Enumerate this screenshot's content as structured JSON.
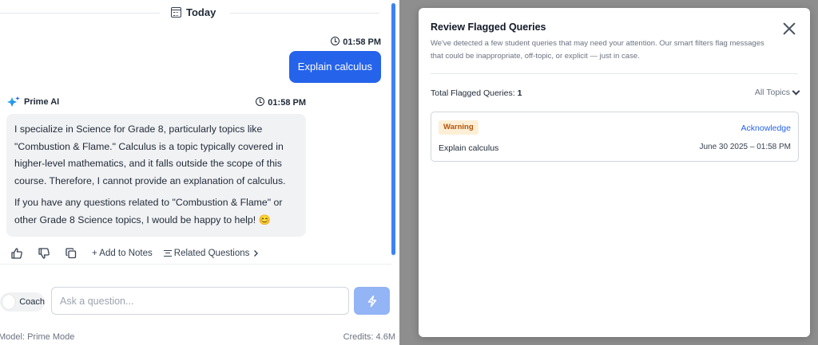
{
  "chat": {
    "day_label": "Today",
    "user_message": {
      "time": "01:58 PM",
      "text": "Explain calculus"
    },
    "ai_message": {
      "sender": "Prime AI",
      "time": "01:58 PM",
      "paragraph1": "I specialize in Science for Grade 8, particularly topics like \"Combustion & Flame.\" Calculus is a topic typically covered in higher-level mathematics, and it falls outside the scope of this course. Therefore, I cannot provide an explanation of calculus.",
      "paragraph2": "If you have any questions related to \"Combustion & Flame\" or other Grade 8 Science topics, I would be happy to help! 😊"
    },
    "actions": {
      "add_notes": "+ Add to Notes",
      "related": "Related Questions"
    },
    "coach_label": "Coach",
    "input_placeholder": "Ask a question...",
    "model": "Model: Prime Mode",
    "credits": "Credits: 4.6M"
  },
  "modal": {
    "title": "Review Flagged Queries",
    "description": "We've detected a few student queries that may need your attention. Our smart filters flag messages that could be inappropriate, off-topic, or explicit — just in case.",
    "total_label": "Total Flagged Queries:",
    "total_count": "1",
    "filter_label": "All Topics",
    "items": [
      {
        "badge": "Warning",
        "action": "Acknowledge",
        "query": "Explain calculus",
        "date": "June 30 2025 – 01:58 PM"
      }
    ]
  },
  "colors": {
    "accent": "#2563eb",
    "send_disabled": "#93b4f5",
    "warning_bg": "#fdefd6",
    "warning_text": "#b45309",
    "backdrop": "#8e8e8e"
  },
  "icons": [
    "calendar-icon",
    "clock-icon",
    "sparkle-icon",
    "thumbs-up-icon",
    "thumbs-down-icon",
    "copy-icon",
    "list-icon",
    "chevron-right-icon",
    "lightning-icon",
    "close-icon",
    "chevron-down-icon"
  ]
}
